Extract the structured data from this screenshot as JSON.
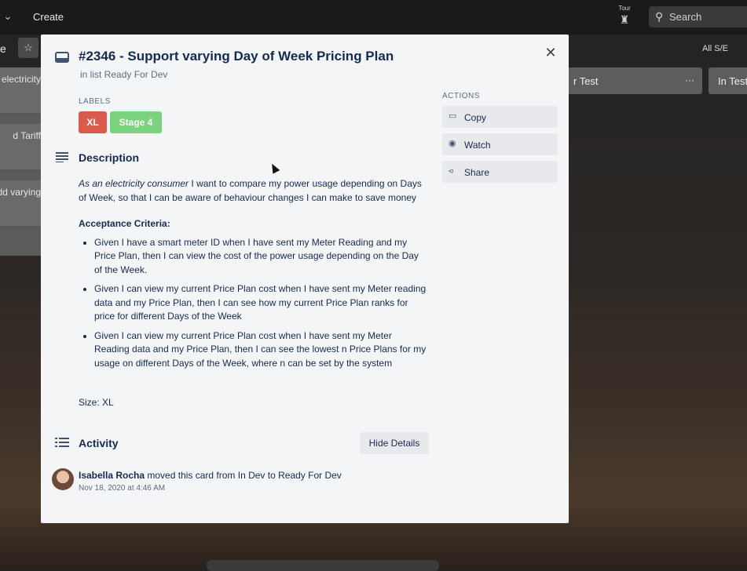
{
  "topbar": {
    "create_label": "Create",
    "tour_label": "Tour",
    "search_placeholder": "Search"
  },
  "board": {
    "title_fragment": "e",
    "view_label": "All S/E",
    "left_cards": [
      "electricity",
      "d Tariff",
      "dd varying"
    ],
    "columns": [
      {
        "title": "r Test",
        "menu": "···"
      },
      {
        "title": "In Test"
      }
    ]
  },
  "card": {
    "title": "#2346 - Support varying Day of Week Pricing Plan",
    "in_list": "in list Ready For Dev",
    "labels_heading": "LABELS",
    "labels": [
      {
        "text": "XL",
        "color": "#d95b4c"
      },
      {
        "text": "Stage 4",
        "color": "#7bd37e"
      }
    ],
    "description_heading": "Description",
    "description": {
      "intro_emphasis": "As an electricity consumer",
      "intro_rest": " I want to compare my power usage depending on Days of Week, so that I can be aware of behaviour changes I can make to save money",
      "criteria_heading": "Acceptance Criteria:",
      "criteria": [
        "Given I have a smart meter ID when I have sent my Meter Reading and my Price Plan, then I can view the cost of the power usage depending on the Day of the Week.",
        "Given I can view my current Price Plan cost when I have sent my Meter reading data and my Price Plan, then I can see how my current Price Plan ranks for price for different Days of the Week",
        "Given I can view my current Price Plan cost when I have sent my Meter Reading data and my Price Plan, then I can see the lowest n Price Plans for my usage on different Days of the Week, where n can be set by the system"
      ],
      "size": "Size: XL"
    },
    "activity_heading": "Activity",
    "hide_details_label": "Hide Details",
    "activity": {
      "user": "Isabella Rocha",
      "action": " moved this card from In Dev to Ready For Dev",
      "time": "Nov 18, 2020 at 4:46 AM"
    },
    "actions_heading": "ACTIONS",
    "actions": [
      {
        "label": "Copy",
        "icon": "card-icon"
      },
      {
        "label": "Watch",
        "icon": "eye-icon"
      },
      {
        "label": "Share",
        "icon": "share-icon"
      }
    ]
  }
}
